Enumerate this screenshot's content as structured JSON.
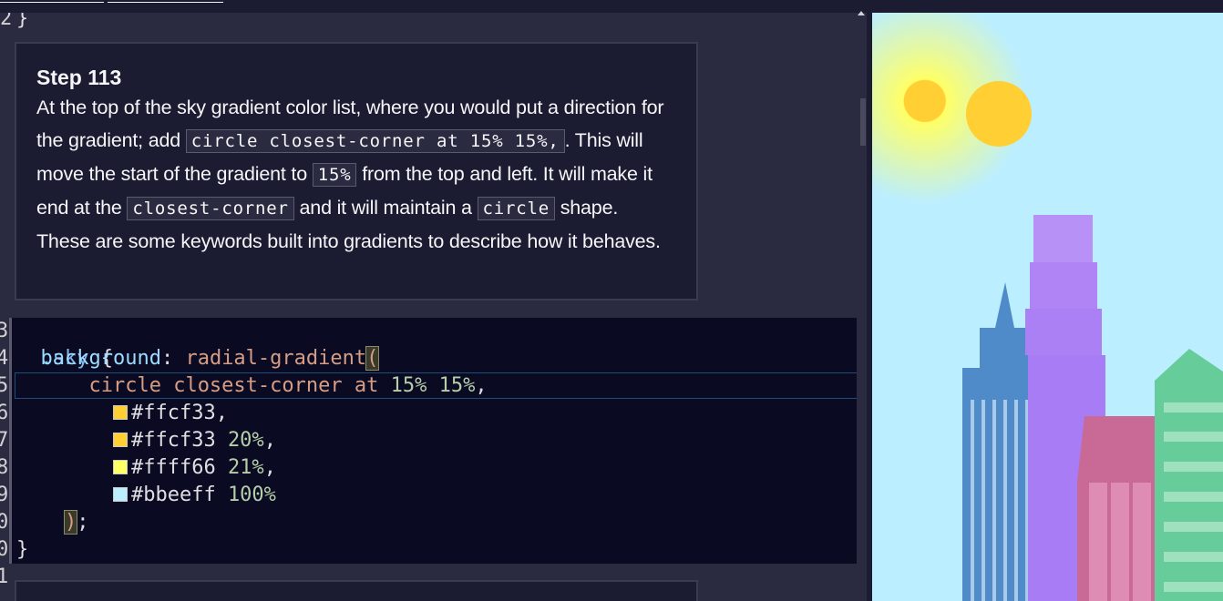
{
  "editor": {
    "prev_line": "}",
    "step": {
      "title": "Step 113",
      "segments": [
        {
          "type": "text",
          "value": "At the top of the sky gradient color list, where you would put a direction for the gradient; add "
        },
        {
          "type": "code",
          "value": "circle closest-corner at 15% 15%,"
        },
        {
          "type": "text",
          "value": ". This will move the start of the gradient to "
        },
        {
          "type": "code",
          "value": "15%"
        },
        {
          "type": "text",
          "value": " from the top and left. It will make it end at the "
        },
        {
          "type": "code",
          "value": "closest-corner"
        },
        {
          "type": "text",
          "value": " and it will maintain a "
        },
        {
          "type": "code",
          "value": "circle"
        },
        {
          "type": "text",
          "value": " shape. These are some keywords built into gradients to describe how it behaves."
        }
      ]
    },
    "code": {
      "selector": ".sky",
      "open_brace": "{",
      "property": "background",
      "colon": ":",
      "function": "radial-gradient",
      "open_paren": "(",
      "editable_line": {
        "keywords": "circle closest-corner at",
        "numbers": "15% 15%",
        "trailing": ","
      },
      "stops": [
        {
          "color": "#ffcf33",
          "label": "#ffcf33",
          "pos": "",
          "trailing": ","
        },
        {
          "color": "#ffcf33",
          "label": "#ffcf33",
          "pos": "20%",
          "trailing": ","
        },
        {
          "color": "#ffff66",
          "label": "#ffff66",
          "pos": "21%",
          "trailing": ","
        },
        {
          "color": "#bbeeff",
          "label": "#bbeeff",
          "pos": "100%",
          "trailing": ""
        }
      ],
      "close_paren": ")",
      "semicolon": ";",
      "close_brace": "}"
    },
    "gutter_numbers": [
      "2",
      "3",
      "4",
      "5",
      "6",
      "7",
      "8",
      "9",
      "0",
      "0",
      "1"
    ]
  },
  "preview": {
    "sky_gradient": [
      "#ffcf33",
      "#ffcf33 20%",
      "#ffff66 21%",
      "#bbeeff 100%"
    ],
    "sun_color": "#ffcf33",
    "buildings": [
      {
        "name": "blue-tower",
        "color": "#4f8ac9"
      },
      {
        "name": "purple-tower",
        "color": "#a87cf4"
      },
      {
        "name": "pink-building",
        "color": "#c96996"
      },
      {
        "name": "green-building",
        "color": "#66cc99"
      }
    ]
  }
}
